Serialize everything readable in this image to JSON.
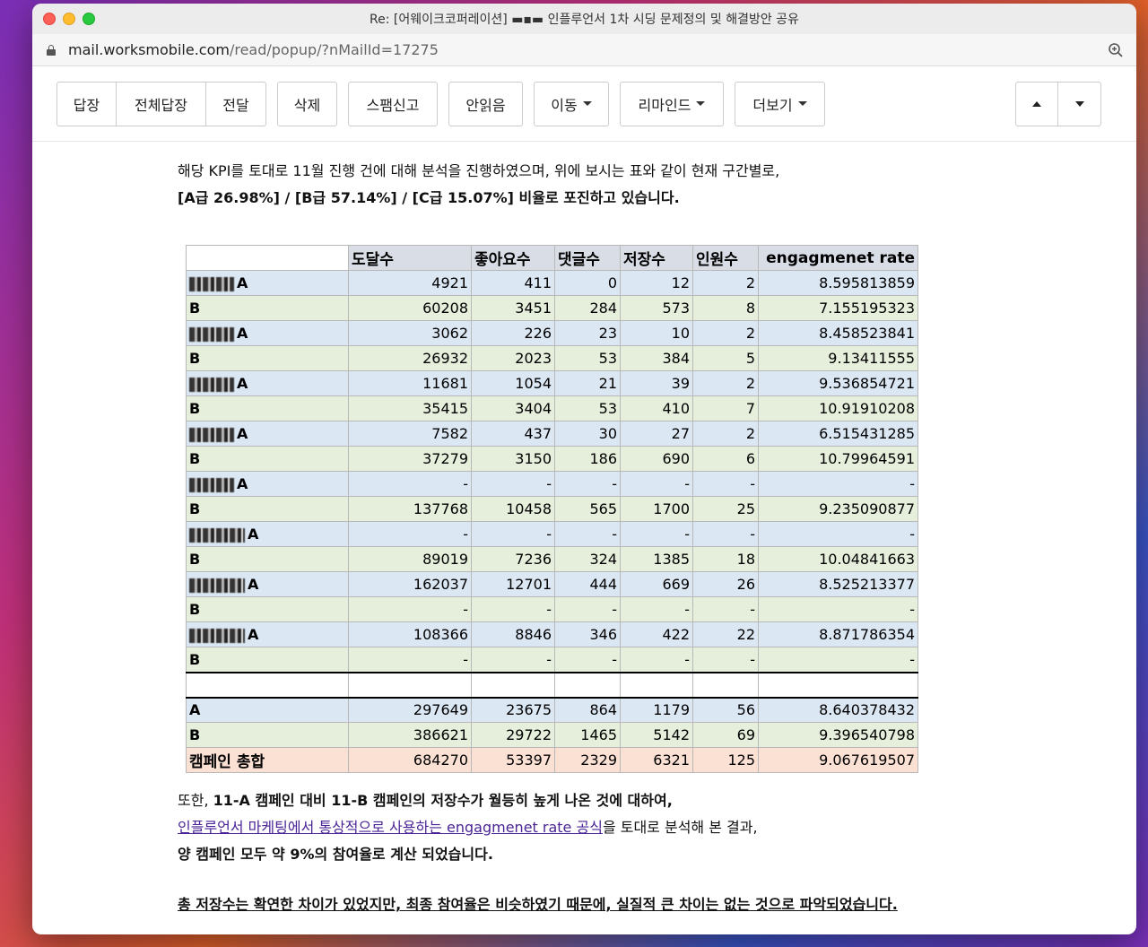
{
  "window": {
    "title": "Re: [어웨이크코퍼레이션] ▬▪▬ 인플루언서 1차 시딩 문제정의 및 해결방안 공유",
    "url_host": "mail.worksmobile.com",
    "url_path": "/read/popup/?nMailId=17275"
  },
  "toolbar": {
    "reply": "답장",
    "reply_all": "전체답장",
    "forward": "전달",
    "delete": "삭제",
    "spam": "스팸신고",
    "unread": "안읽음",
    "move": "이동",
    "remind": "리마인드",
    "more": "더보기"
  },
  "body": {
    "intro_line1": "해당 KPI를 토대로 11월 진행 건에 대해 분석을 진행하였으며, 위에 보시는 표와 같이 현재 구간별로,",
    "intro_line2": "[A급 26.98%] / [B급 57.14%] / [C급 15.07%] 비율로 포진하고 있습니다.",
    "after_prefix": "또한, ",
    "after_bold": "11-A 캠페인 대비 11-B 캠페인의 저장수가 월등히 높게 나온 것에 대하여,",
    "link_text": "인플루언서 마케팅에서 통상적으로 사용하는 engagmenet rate 공식",
    "link_suffix": "을 토대로 분석해 본 결과,",
    "result_line": "양 캠페인 모두 약 9%의 참여율로 계산 되었습니다.",
    "conclusion": "총 저장수는 확연한 차이가 있었지만, 최종 참여율은 비슷하였기 때문에, 실질적 큰 차이는 없는 것으로 파악되었습니다."
  },
  "table": {
    "headers": [
      "",
      "도달수",
      "좋아요수",
      "댓글수",
      "저장수",
      "인원수",
      "engagmenet rate"
    ],
    "rows": [
      {
        "name": "A",
        "type": "a",
        "cells": [
          "4921",
          "411",
          "0",
          "12",
          "2",
          "8.595813859"
        ]
      },
      {
        "name": "B",
        "type": "b",
        "cells": [
          "60208",
          "3451",
          "284",
          "573",
          "8",
          "7.155195323"
        ]
      },
      {
        "name": "A",
        "type": "a",
        "cells": [
          "3062",
          "226",
          "23",
          "10",
          "2",
          "8.458523841"
        ]
      },
      {
        "name": "B",
        "type": "b",
        "cells": [
          "26932",
          "2023",
          "53",
          "384",
          "5",
          "9.13411555"
        ]
      },
      {
        "name": "A",
        "type": "a",
        "cells": [
          "11681",
          "1054",
          "21",
          "39",
          "2",
          "9.536854721"
        ]
      },
      {
        "name": "B",
        "type": "b",
        "cells": [
          "35415",
          "3404",
          "53",
          "410",
          "7",
          "10.91910208"
        ]
      },
      {
        "name": "A",
        "type": "a",
        "cells": [
          "7582",
          "437",
          "30",
          "27",
          "2",
          "6.515431285"
        ]
      },
      {
        "name": "B",
        "type": "b",
        "cells": [
          "37279",
          "3150",
          "186",
          "690",
          "6",
          "10.79964591"
        ]
      },
      {
        "name": "A",
        "type": "a",
        "cells": [
          "-",
          "-",
          "-",
          "-",
          "-",
          "-"
        ]
      },
      {
        "name": "B",
        "type": "b",
        "cells": [
          "137768",
          "10458",
          "565",
          "1700",
          "25",
          "9.235090877"
        ]
      },
      {
        "name": "A",
        "type": "a",
        "cells": [
          "-",
          "-",
          "-",
          "-",
          "-",
          "-"
        ]
      },
      {
        "name": "B",
        "type": "b",
        "cells": [
          "89019",
          "7236",
          "324",
          "1385",
          "18",
          "10.04841663"
        ]
      },
      {
        "name": "A",
        "type": "a",
        "cells": [
          "162037",
          "12701",
          "444",
          "669",
          "26",
          "8.525213377"
        ]
      },
      {
        "name": "B",
        "type": "b",
        "cells": [
          "-",
          "-",
          "-",
          "-",
          "-",
          "-"
        ]
      },
      {
        "name": "A",
        "type": "a",
        "cells": [
          "108366",
          "8846",
          "346",
          "422",
          "22",
          "8.871786354"
        ]
      },
      {
        "name": "B",
        "type": "b",
        "cells": [
          "-",
          "-",
          "-",
          "-",
          "-",
          "-"
        ]
      }
    ],
    "totals": [
      {
        "name": "A",
        "type": "a",
        "cells": [
          "297649",
          "23675",
          "864",
          "1179",
          "56",
          "8.640378432"
        ]
      },
      {
        "name": "B",
        "type": "b",
        "cells": [
          "386621",
          "29722",
          "1465",
          "5142",
          "69",
          "9.396540798"
        ]
      },
      {
        "name": "캠페인 총합",
        "type": "total",
        "cells": [
          "684270",
          "53397",
          "2329",
          "6321",
          "125",
          "9.067619507"
        ]
      }
    ]
  }
}
